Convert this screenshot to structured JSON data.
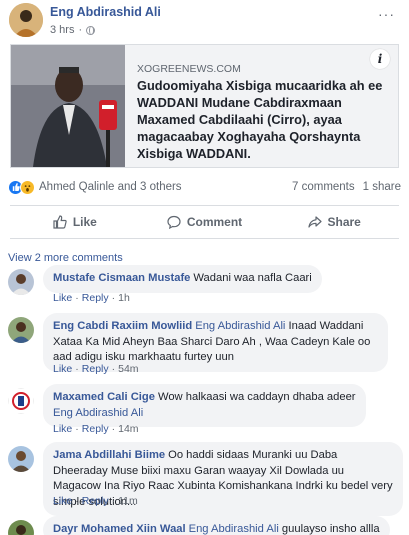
{
  "post": {
    "author": "Eng Abdirashid Ali",
    "time": "3 hrs",
    "more_icon": "···"
  },
  "link": {
    "source": "XOGREENEWS.COM",
    "title": "Gudoomiyaha Xisbiga mucaaridka ah ee WADDANI Mudane Cabdiraxmaan Maxamed Cabdilaahi (Cirro), ayaa magacaabay Xoghayaha Qorshaynta Xisbiga WADDANI.",
    "info_icon": "i"
  },
  "reactions": {
    "names": "Ahmed Qalinle and 3 others",
    "comments": "7 comments",
    "shares": "1 share"
  },
  "actions": {
    "like": "Like",
    "comment": "Comment",
    "share": "Share"
  },
  "view_more": "View 2 more comments",
  "comments": [
    {
      "name": "Mustafe Cismaan Mustafe",
      "tag": "",
      "text": "Wadani waa nafla Caari",
      "like": "Like",
      "reply": "Reply",
      "time": "1h"
    },
    {
      "name": "Eng Cabdi Raxiim Mowliid",
      "tag": "Eng Abdirashid Ali",
      "text": "Inaad Waddani Xataa Ka Mid Aheyn Baa Sharci Daro Ah , Waa Cadeyn Kale oo aad adigu isku markhaatu furtey uun",
      "like": "Like",
      "reply": "Reply",
      "time": "54m"
    },
    {
      "name": "Maxamed Cali Cige",
      "tag": "Eng Abdirashid Ali",
      "text": "Wow halkaasi wa caddayn dhaba adeer",
      "like": "Like",
      "reply": "Reply",
      "time": "14m"
    },
    {
      "name": "Jama Abdillahi Biime",
      "tag": "",
      "text": "Oo haddi sidaas Muranki uu Daba Dheeraday Muse biixi maxu Garan waayay Xil Dowlada uu Magacow Ina Riyo Raac Xubinta Komishankana Indrki ku bedel very simple solution...",
      "like": "Like",
      "reply": "Reply",
      "time": "11m"
    },
    {
      "name": "Dayr Mohamed Xiin Waal",
      "tag": "Eng Abdirashid Ali",
      "text": "guulayso insho allla",
      "like": "",
      "reply": "",
      "time": ""
    }
  ],
  "colors": {
    "link": "#385898",
    "text": "#1d2129",
    "muted": "#606770",
    "bubble": "#f2f3f5",
    "like_blue": "#1877f2"
  }
}
